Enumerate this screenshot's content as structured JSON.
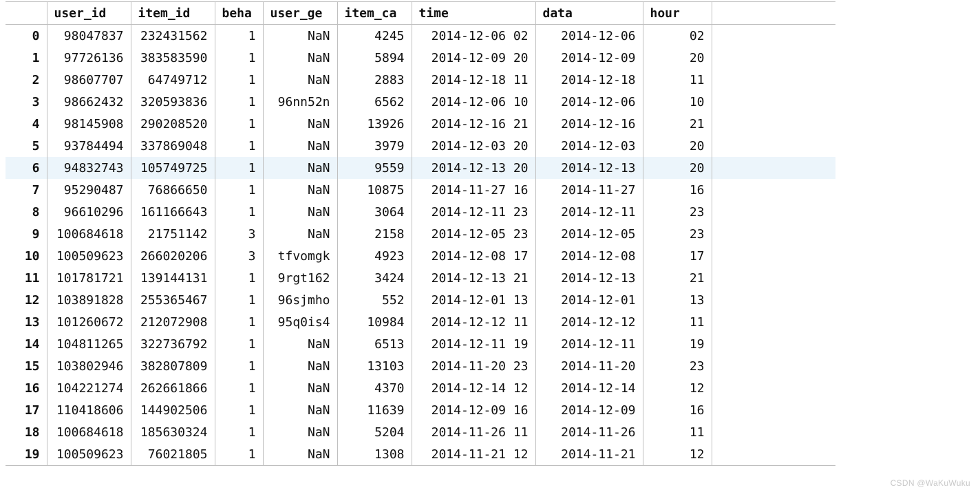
{
  "watermark": "CSDN @WaKuWuku",
  "highlighted_row_index": 6,
  "columns": [
    {
      "key": "idx",
      "label": ""
    },
    {
      "key": "user_id",
      "label": "user_id"
    },
    {
      "key": "item_id",
      "label": "item_id"
    },
    {
      "key": "beha",
      "label": "beha"
    },
    {
      "key": "user_ge",
      "label": "user_ge"
    },
    {
      "key": "item_ca",
      "label": "item_ca"
    },
    {
      "key": "time",
      "label": "time"
    },
    {
      "key": "data_",
      "label": "data"
    },
    {
      "key": "hour",
      "label": "hour"
    }
  ],
  "rows": [
    {
      "idx": "0",
      "user_id": "98047837",
      "item_id": "232431562",
      "beha": "1",
      "user_ge": "NaN",
      "item_ca": "4245",
      "time": "2014-12-06 02",
      "data_": "2014-12-06",
      "hour": "02"
    },
    {
      "idx": "1",
      "user_id": "97726136",
      "item_id": "383583590",
      "beha": "1",
      "user_ge": "NaN",
      "item_ca": "5894",
      "time": "2014-12-09 20",
      "data_": "2014-12-09",
      "hour": "20"
    },
    {
      "idx": "2",
      "user_id": "98607707",
      "item_id": "64749712",
      "beha": "1",
      "user_ge": "NaN",
      "item_ca": "2883",
      "time": "2014-12-18 11",
      "data_": "2014-12-18",
      "hour": "11"
    },
    {
      "idx": "3",
      "user_id": "98662432",
      "item_id": "320593836",
      "beha": "1",
      "user_ge": "96nn52n",
      "item_ca": "6562",
      "time": "2014-12-06 10",
      "data_": "2014-12-06",
      "hour": "10"
    },
    {
      "idx": "4",
      "user_id": "98145908",
      "item_id": "290208520",
      "beha": "1",
      "user_ge": "NaN",
      "item_ca": "13926",
      "time": "2014-12-16 21",
      "data_": "2014-12-16",
      "hour": "21"
    },
    {
      "idx": "5",
      "user_id": "93784494",
      "item_id": "337869048",
      "beha": "1",
      "user_ge": "NaN",
      "item_ca": "3979",
      "time": "2014-12-03 20",
      "data_": "2014-12-03",
      "hour": "20"
    },
    {
      "idx": "6",
      "user_id": "94832743",
      "item_id": "105749725",
      "beha": "1",
      "user_ge": "NaN",
      "item_ca": "9559",
      "time": "2014-12-13 20",
      "data_": "2014-12-13",
      "hour": "20"
    },
    {
      "idx": "7",
      "user_id": "95290487",
      "item_id": "76866650",
      "beha": "1",
      "user_ge": "NaN",
      "item_ca": "10875",
      "time": "2014-11-27 16",
      "data_": "2014-11-27",
      "hour": "16"
    },
    {
      "idx": "8",
      "user_id": "96610296",
      "item_id": "161166643",
      "beha": "1",
      "user_ge": "NaN",
      "item_ca": "3064",
      "time": "2014-12-11 23",
      "data_": "2014-12-11",
      "hour": "23"
    },
    {
      "idx": "9",
      "user_id": "100684618",
      "item_id": "21751142",
      "beha": "3",
      "user_ge": "NaN",
      "item_ca": "2158",
      "time": "2014-12-05 23",
      "data_": "2014-12-05",
      "hour": "23"
    },
    {
      "idx": "10",
      "user_id": "100509623",
      "item_id": "266020206",
      "beha": "3",
      "user_ge": "tfvomgk",
      "item_ca": "4923",
      "time": "2014-12-08 17",
      "data_": "2014-12-08",
      "hour": "17"
    },
    {
      "idx": "11",
      "user_id": "101781721",
      "item_id": "139144131",
      "beha": "1",
      "user_ge": "9rgt162",
      "item_ca": "3424",
      "time": "2014-12-13 21",
      "data_": "2014-12-13",
      "hour": "21"
    },
    {
      "idx": "12",
      "user_id": "103891828",
      "item_id": "255365467",
      "beha": "1",
      "user_ge": "96sjmho",
      "item_ca": "552",
      "time": "2014-12-01 13",
      "data_": "2014-12-01",
      "hour": "13"
    },
    {
      "idx": "13",
      "user_id": "101260672",
      "item_id": "212072908",
      "beha": "1",
      "user_ge": "95q0is4",
      "item_ca": "10984",
      "time": "2014-12-12 11",
      "data_": "2014-12-12",
      "hour": "11"
    },
    {
      "idx": "14",
      "user_id": "104811265",
      "item_id": "322736792",
      "beha": "1",
      "user_ge": "NaN",
      "item_ca": "6513",
      "time": "2014-12-11 19",
      "data_": "2014-12-11",
      "hour": "19"
    },
    {
      "idx": "15",
      "user_id": "103802946",
      "item_id": "382807809",
      "beha": "1",
      "user_ge": "NaN",
      "item_ca": "13103",
      "time": "2014-11-20 23",
      "data_": "2014-11-20",
      "hour": "23"
    },
    {
      "idx": "16",
      "user_id": "104221274",
      "item_id": "262661866",
      "beha": "1",
      "user_ge": "NaN",
      "item_ca": "4370",
      "time": "2014-12-14 12",
      "data_": "2014-12-14",
      "hour": "12"
    },
    {
      "idx": "17",
      "user_id": "110418606",
      "item_id": "144902506",
      "beha": "1",
      "user_ge": "NaN",
      "item_ca": "11639",
      "time": "2014-12-09 16",
      "data_": "2014-12-09",
      "hour": "16"
    },
    {
      "idx": "18",
      "user_id": "100684618",
      "item_id": "185630324",
      "beha": "1",
      "user_ge": "NaN",
      "item_ca": "5204",
      "time": "2014-11-26 11",
      "data_": "2014-11-26",
      "hour": "11"
    },
    {
      "idx": "19",
      "user_id": "100509623",
      "item_id": "76021805",
      "beha": "1",
      "user_ge": "NaN",
      "item_ca": "1308",
      "time": "2014-11-21 12",
      "data_": "2014-11-21",
      "hour": "12"
    }
  ]
}
